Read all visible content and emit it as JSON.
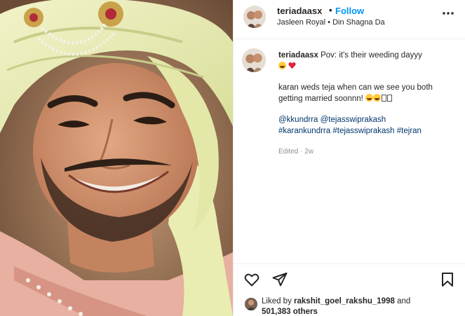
{
  "post": {
    "username": "teriadaasx",
    "dot": "•",
    "follow_label": "Follow",
    "audio": {
      "artist": "Jasleen Royal",
      "separator": " • ",
      "track": "Din Shagna Da"
    }
  },
  "caption": {
    "username": "teriadaasx",
    "line1": "Pov: it's their weeding dayyy",
    "line2": "karan weds teja when can we see you both getting married soonnn!",
    "mentions": [
      "@kkundrra",
      "@tejasswiprakash"
    ],
    "hashtags": [
      "#karankundrra",
      "#tejasswiprakash",
      "#tejran"
    ],
    "edited": "Edited · 2w"
  },
  "likes": {
    "prefix": "Liked by ",
    "user": "rakshit_goel_rakshu_1998",
    "middle": " and",
    "count": "501,383 others"
  },
  "icons": {
    "like": "heart-outline-icon",
    "share": "paper-plane-icon",
    "save": "bookmark-icon",
    "more": "more-horizontal-icon"
  },
  "colors": {
    "link_blue": "#0095f6",
    "hashtag_blue": "#00376b",
    "muted": "#8e8e8e"
  }
}
